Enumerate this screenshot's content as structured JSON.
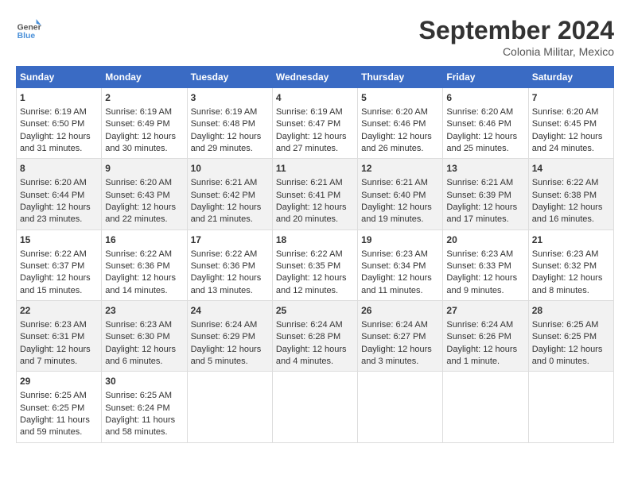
{
  "header": {
    "logo_line1": "General",
    "logo_line2": "Blue",
    "title": "September 2024",
    "subtitle": "Colonia Militar, Mexico"
  },
  "weekdays": [
    "Sunday",
    "Monday",
    "Tuesday",
    "Wednesday",
    "Thursday",
    "Friday",
    "Saturday"
  ],
  "weeks": [
    [
      {
        "day": "1",
        "lines": [
          "Sunrise: 6:19 AM",
          "Sunset: 6:50 PM",
          "Daylight: 12 hours",
          "and 31 minutes."
        ]
      },
      {
        "day": "2",
        "lines": [
          "Sunrise: 6:19 AM",
          "Sunset: 6:49 PM",
          "Daylight: 12 hours",
          "and 30 minutes."
        ]
      },
      {
        "day": "3",
        "lines": [
          "Sunrise: 6:19 AM",
          "Sunset: 6:48 PM",
          "Daylight: 12 hours",
          "and 29 minutes."
        ]
      },
      {
        "day": "4",
        "lines": [
          "Sunrise: 6:19 AM",
          "Sunset: 6:47 PM",
          "Daylight: 12 hours",
          "and 27 minutes."
        ]
      },
      {
        "day": "5",
        "lines": [
          "Sunrise: 6:20 AM",
          "Sunset: 6:46 PM",
          "Daylight: 12 hours",
          "and 26 minutes."
        ]
      },
      {
        "day": "6",
        "lines": [
          "Sunrise: 6:20 AM",
          "Sunset: 6:46 PM",
          "Daylight: 12 hours",
          "and 25 minutes."
        ]
      },
      {
        "day": "7",
        "lines": [
          "Sunrise: 6:20 AM",
          "Sunset: 6:45 PM",
          "Daylight: 12 hours",
          "and 24 minutes."
        ]
      }
    ],
    [
      {
        "day": "8",
        "lines": [
          "Sunrise: 6:20 AM",
          "Sunset: 6:44 PM",
          "Daylight: 12 hours",
          "and 23 minutes."
        ]
      },
      {
        "day": "9",
        "lines": [
          "Sunrise: 6:20 AM",
          "Sunset: 6:43 PM",
          "Daylight: 12 hours",
          "and 22 minutes."
        ]
      },
      {
        "day": "10",
        "lines": [
          "Sunrise: 6:21 AM",
          "Sunset: 6:42 PM",
          "Daylight: 12 hours",
          "and 21 minutes."
        ]
      },
      {
        "day": "11",
        "lines": [
          "Sunrise: 6:21 AM",
          "Sunset: 6:41 PM",
          "Daylight: 12 hours",
          "and 20 minutes."
        ]
      },
      {
        "day": "12",
        "lines": [
          "Sunrise: 6:21 AM",
          "Sunset: 6:40 PM",
          "Daylight: 12 hours",
          "and 19 minutes."
        ]
      },
      {
        "day": "13",
        "lines": [
          "Sunrise: 6:21 AM",
          "Sunset: 6:39 PM",
          "Daylight: 12 hours",
          "and 17 minutes."
        ]
      },
      {
        "day": "14",
        "lines": [
          "Sunrise: 6:22 AM",
          "Sunset: 6:38 PM",
          "Daylight: 12 hours",
          "and 16 minutes."
        ]
      }
    ],
    [
      {
        "day": "15",
        "lines": [
          "Sunrise: 6:22 AM",
          "Sunset: 6:37 PM",
          "Daylight: 12 hours",
          "and 15 minutes."
        ]
      },
      {
        "day": "16",
        "lines": [
          "Sunrise: 6:22 AM",
          "Sunset: 6:36 PM",
          "Daylight: 12 hours",
          "and 14 minutes."
        ]
      },
      {
        "day": "17",
        "lines": [
          "Sunrise: 6:22 AM",
          "Sunset: 6:36 PM",
          "Daylight: 12 hours",
          "and 13 minutes."
        ]
      },
      {
        "day": "18",
        "lines": [
          "Sunrise: 6:22 AM",
          "Sunset: 6:35 PM",
          "Daylight: 12 hours",
          "and 12 minutes."
        ]
      },
      {
        "day": "19",
        "lines": [
          "Sunrise: 6:23 AM",
          "Sunset: 6:34 PM",
          "Daylight: 12 hours",
          "and 11 minutes."
        ]
      },
      {
        "day": "20",
        "lines": [
          "Sunrise: 6:23 AM",
          "Sunset: 6:33 PM",
          "Daylight: 12 hours",
          "and 9 minutes."
        ]
      },
      {
        "day": "21",
        "lines": [
          "Sunrise: 6:23 AM",
          "Sunset: 6:32 PM",
          "Daylight: 12 hours",
          "and 8 minutes."
        ]
      }
    ],
    [
      {
        "day": "22",
        "lines": [
          "Sunrise: 6:23 AM",
          "Sunset: 6:31 PM",
          "Daylight: 12 hours",
          "and 7 minutes."
        ]
      },
      {
        "day": "23",
        "lines": [
          "Sunrise: 6:23 AM",
          "Sunset: 6:30 PM",
          "Daylight: 12 hours",
          "and 6 minutes."
        ]
      },
      {
        "day": "24",
        "lines": [
          "Sunrise: 6:24 AM",
          "Sunset: 6:29 PM",
          "Daylight: 12 hours",
          "and 5 minutes."
        ]
      },
      {
        "day": "25",
        "lines": [
          "Sunrise: 6:24 AM",
          "Sunset: 6:28 PM",
          "Daylight: 12 hours",
          "and 4 minutes."
        ]
      },
      {
        "day": "26",
        "lines": [
          "Sunrise: 6:24 AM",
          "Sunset: 6:27 PM",
          "Daylight: 12 hours",
          "and 3 minutes."
        ]
      },
      {
        "day": "27",
        "lines": [
          "Sunrise: 6:24 AM",
          "Sunset: 6:26 PM",
          "Daylight: 12 hours",
          "and 1 minute."
        ]
      },
      {
        "day": "28",
        "lines": [
          "Sunrise: 6:25 AM",
          "Sunset: 6:25 PM",
          "Daylight: 12 hours",
          "and 0 minutes."
        ]
      }
    ],
    [
      {
        "day": "29",
        "lines": [
          "Sunrise: 6:25 AM",
          "Sunset: 6:25 PM",
          "Daylight: 11 hours",
          "and 59 minutes."
        ]
      },
      {
        "day": "30",
        "lines": [
          "Sunrise: 6:25 AM",
          "Sunset: 6:24 PM",
          "Daylight: 11 hours",
          "and 58 minutes."
        ]
      },
      {
        "day": "",
        "lines": []
      },
      {
        "day": "",
        "lines": []
      },
      {
        "day": "",
        "lines": []
      },
      {
        "day": "",
        "lines": []
      },
      {
        "day": "",
        "lines": []
      }
    ]
  ]
}
